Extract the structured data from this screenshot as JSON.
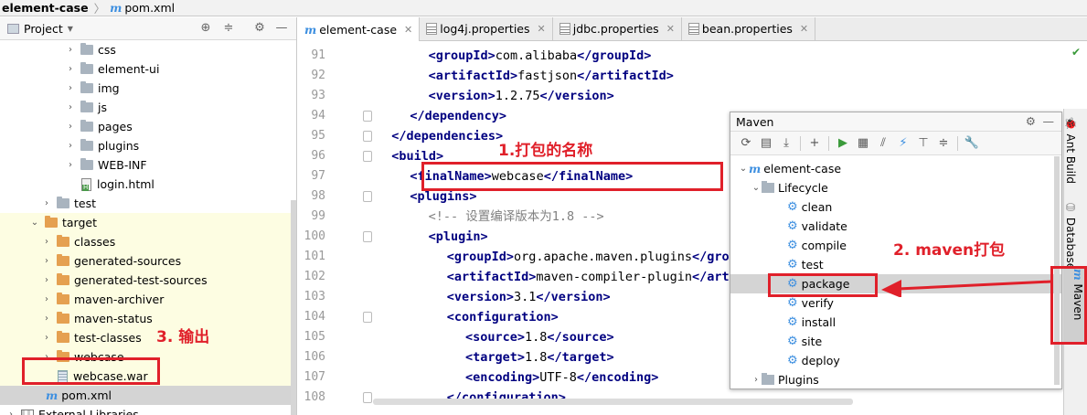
{
  "breadcrumb": {
    "project": "element-case",
    "file": "pom.xml"
  },
  "project_panel": {
    "title": "Project"
  },
  "tree": [
    {
      "label": "css",
      "indent": 5,
      "type": "folder",
      "arrow": "›",
      "bg": ""
    },
    {
      "label": "element-ui",
      "indent": 5,
      "type": "folder",
      "arrow": "›",
      "bg": ""
    },
    {
      "label": "img",
      "indent": 5,
      "type": "folder",
      "arrow": "›",
      "bg": ""
    },
    {
      "label": "js",
      "indent": 5,
      "type": "folder",
      "arrow": "›",
      "bg": ""
    },
    {
      "label": "pages",
      "indent": 5,
      "type": "folder",
      "arrow": "›",
      "bg": ""
    },
    {
      "label": "plugins",
      "indent": 5,
      "type": "folder",
      "arrow": "›",
      "bg": ""
    },
    {
      "label": "WEB-INF",
      "indent": 5,
      "type": "folder",
      "arrow": "›",
      "bg": ""
    },
    {
      "label": "login.html",
      "indent": 5,
      "type": "html",
      "arrow": "",
      "bg": ""
    },
    {
      "label": "test",
      "indent": 3,
      "type": "folder",
      "arrow": "›",
      "bg": ""
    },
    {
      "label": "target",
      "indent": 2,
      "type": "ofolder",
      "arrow": "⌄",
      "bg": "y"
    },
    {
      "label": "classes",
      "indent": 3,
      "type": "ofolder",
      "arrow": "›",
      "bg": "y"
    },
    {
      "label": "generated-sources",
      "indent": 3,
      "type": "ofolder",
      "arrow": "›",
      "bg": "y"
    },
    {
      "label": "generated-test-sources",
      "indent": 3,
      "type": "ofolder",
      "arrow": "›",
      "bg": "y"
    },
    {
      "label": "maven-archiver",
      "indent": 3,
      "type": "ofolder",
      "arrow": "›",
      "bg": "y"
    },
    {
      "label": "maven-status",
      "indent": 3,
      "type": "ofolder",
      "arrow": "›",
      "bg": "y"
    },
    {
      "label": "test-classes",
      "indent": 3,
      "type": "ofolder",
      "arrow": "›",
      "bg": "y"
    },
    {
      "label": "webcase",
      "indent": 3,
      "type": "ofolder",
      "arrow": "›",
      "bg": "y"
    },
    {
      "label": "webcase.war",
      "indent": 3,
      "type": "war",
      "arrow": "",
      "bg": "y"
    },
    {
      "label": "pom.xml",
      "indent": 2,
      "type": "m",
      "arrow": "",
      "bg": "sel"
    },
    {
      "label": "External Libraries",
      "indent": 0,
      "type": "lib",
      "arrow": "›",
      "bg": ""
    }
  ],
  "tabs": [
    {
      "label": "element-case",
      "icon": "m",
      "active": true
    },
    {
      "label": "log4j.properties",
      "icon": "prop",
      "active": false
    },
    {
      "label": "jdbc.properties",
      "icon": "prop",
      "active": false
    },
    {
      "label": "bean.properties",
      "icon": "prop",
      "active": false
    }
  ],
  "lines": [
    {
      "n": "91",
      "ind": 6,
      "parts": [
        [
          "t",
          "<groupId>"
        ],
        [
          "x",
          "com.alibaba"
        ],
        [
          "t",
          "</groupId>"
        ]
      ]
    },
    {
      "n": "92",
      "ind": 6,
      "parts": [
        [
          "t",
          "<artifactId>"
        ],
        [
          "x",
          "fastjson"
        ],
        [
          "t",
          "</artifactId>"
        ]
      ]
    },
    {
      "n": "93",
      "ind": 6,
      "parts": [
        [
          "t",
          "<version>"
        ],
        [
          "x",
          "1.2.75"
        ],
        [
          "t",
          "</version>"
        ]
      ]
    },
    {
      "n": "94",
      "ind": 4,
      "parts": [
        [
          "t",
          "</dependency>"
        ]
      ]
    },
    {
      "n": "95",
      "ind": 2,
      "parts": [
        [
          "t",
          "</dependencies>"
        ]
      ]
    },
    {
      "n": "96",
      "ind": 2,
      "parts": [
        [
          "t",
          "<build>"
        ]
      ]
    },
    {
      "n": "97",
      "ind": 4,
      "parts": [
        [
          "t",
          "<finalName>"
        ],
        [
          "x",
          "webcase"
        ],
        [
          "t",
          "</finalName>"
        ]
      ]
    },
    {
      "n": "98",
      "ind": 4,
      "parts": [
        [
          "t",
          "<plugins>"
        ]
      ]
    },
    {
      "n": "99",
      "ind": 6,
      "parts": [
        [
          "c",
          "<!-- 设置编译版本为1.8 -->"
        ]
      ]
    },
    {
      "n": "100",
      "ind": 6,
      "parts": [
        [
          "t",
          "<plugin>"
        ]
      ]
    },
    {
      "n": "101",
      "ind": 8,
      "parts": [
        [
          "t",
          "<groupId>"
        ],
        [
          "x",
          "org.apache.maven.plugins"
        ],
        [
          "t",
          "</groupId>"
        ]
      ]
    },
    {
      "n": "102",
      "ind": 8,
      "parts": [
        [
          "t",
          "<artifactId>"
        ],
        [
          "x",
          "maven-compiler-plugin"
        ],
        [
          "t",
          "</artifactId>"
        ]
      ]
    },
    {
      "n": "103",
      "ind": 8,
      "parts": [
        [
          "t",
          "<version>"
        ],
        [
          "x",
          "3.1"
        ],
        [
          "t",
          "</version>"
        ]
      ]
    },
    {
      "n": "104",
      "ind": 8,
      "parts": [
        [
          "t",
          "<configuration>"
        ]
      ]
    },
    {
      "n": "105",
      "ind": 10,
      "parts": [
        [
          "t",
          "<source>"
        ],
        [
          "x",
          "1.8"
        ],
        [
          "t",
          "</source>"
        ]
      ]
    },
    {
      "n": "106",
      "ind": 10,
      "parts": [
        [
          "t",
          "<target>"
        ],
        [
          "x",
          "1.8"
        ],
        [
          "t",
          "</target>"
        ]
      ]
    },
    {
      "n": "107",
      "ind": 10,
      "parts": [
        [
          "t",
          "<encoding>"
        ],
        [
          "x",
          "UTF-8"
        ],
        [
          "t",
          "</encoding>"
        ]
      ]
    },
    {
      "n": "108",
      "ind": 8,
      "parts": [
        [
          "t",
          "</configuration>"
        ]
      ]
    }
  ],
  "maven": {
    "title": "Maven",
    "root": "element-case",
    "lifecycle": "Lifecycle",
    "goals": [
      "clean",
      "validate",
      "compile",
      "test",
      "package",
      "verify",
      "install",
      "site",
      "deploy"
    ],
    "plugins": "Plugins"
  },
  "side_tabs": [
    "Ant Build",
    "Database",
    "Maven"
  ],
  "annotations": {
    "a1": "1.打包的名称",
    "a2": "2. maven打包",
    "a3": "3. 输出"
  },
  "colors": {
    "annotation": "#e0202a",
    "tag": "#000080",
    "comment": "#808080"
  }
}
